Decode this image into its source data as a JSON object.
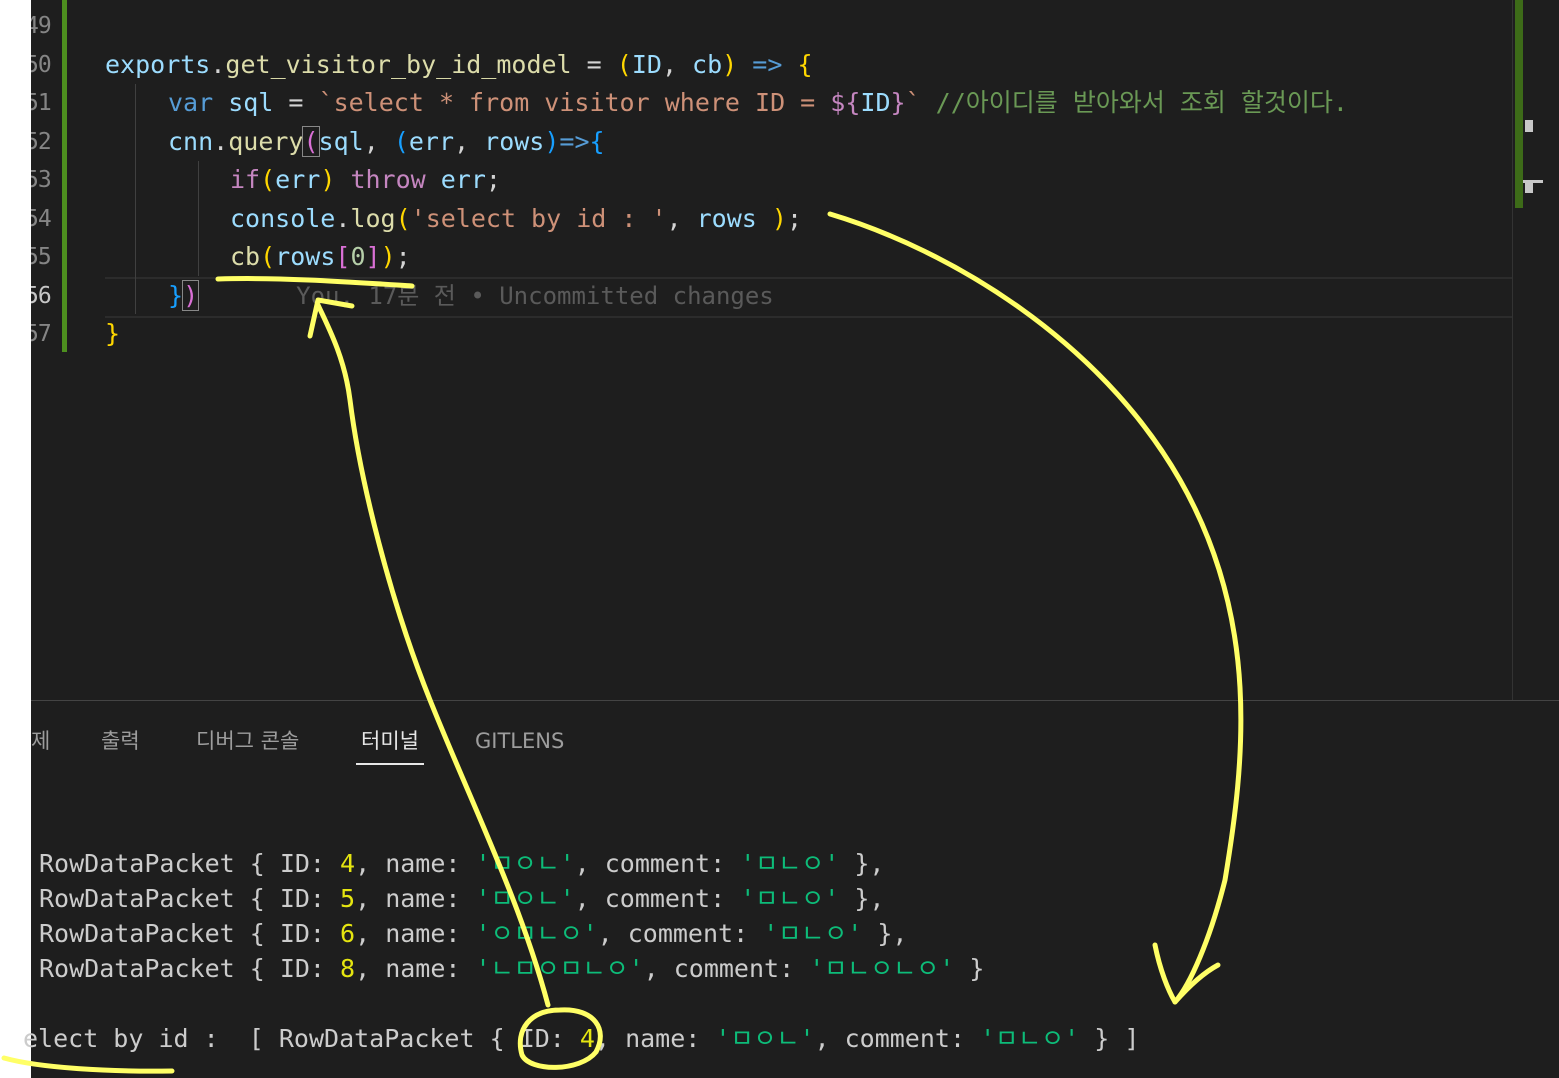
{
  "line_numbers": [
    "49",
    "50",
    "51",
    "52",
    "53",
    "54",
    "55",
    "56",
    "57"
  ],
  "code": {
    "l50": {
      "t1": "exports",
      "t2": ".",
      "t3": "get_visitor_by_id_model",
      "t4": " = ",
      "t5": "(",
      "t6": "ID",
      "t7": ", ",
      "t8": "cb",
      "t9": ")",
      "t10": " => ",
      "t11": "{"
    },
    "l51": {
      "t1": "var",
      "t2": " sql",
      "t3": " = ",
      "t4": "`select * from visitor where ID = ",
      "t5": "${",
      "t6": "ID",
      "t7": "}",
      "t8": "`",
      "t9": " //아이디를 받아와서 조회 할것이다."
    },
    "l52": {
      "t1": "cnn",
      "t2": ".",
      "t3": "query",
      "t4": "(",
      "t5": "sql",
      "t6": ", ",
      "t7": "(",
      "t8": "err",
      "t9": ", ",
      "t10": "rows",
      "t11": ")",
      "t12": "=>",
      "t13": "{"
    },
    "l53": {
      "t1": "if",
      "t2": "(",
      "t3": "err",
      "t4": ")",
      "t5": " throw",
      "t6": " err",
      "t7": ";"
    },
    "l54": {
      "t1": "console",
      "t2": ".",
      "t3": "log",
      "t4": "(",
      "t5": "'select by id : '",
      "t6": ", ",
      "t7": "rows",
      "t8": " ",
      "t9": ")",
      "t10": ";"
    },
    "l55": {
      "t1": "cb",
      "t2": "(",
      "t3": "rows",
      "t4": "[",
      "t5": "0",
      "t6": "]",
      "t7": ")",
      "t8": ";"
    },
    "l56": {
      "t1": "}",
      "t2": ")",
      "blame": "You, 17분 전 • Uncommitted changes"
    },
    "l57": {
      "t1": "}"
    }
  },
  "panel": {
    "tabs": [
      "제",
      "출력",
      "디버그 콘솔",
      "터미널",
      "GITLENS"
    ],
    "active_tab": "터미널"
  },
  "terminal": {
    "rows": [
      {
        "id": "4",
        "name": "'ㅁㅇㄴ'",
        "comment": "'ㅁㄴㅇ'",
        "end": " },"
      },
      {
        "id": "5",
        "name": "'ㅁㅇㄴ'",
        "comment": "'ㅁㄴㅇ'",
        "end": " },"
      },
      {
        "id": "6",
        "name": "'ㅇㅁㄴㅇ'",
        "comment": "'ㅁㄴㅇ'",
        "end": " },"
      },
      {
        "id": "8",
        "name": "'ㄴㅁㅇㅁㄴㅇ'",
        "comment": "'ㅁㄴㅇㄴㅇ'",
        "end": " }"
      }
    ],
    "row_prefix": "RowDataPacket { ID: ",
    "name_key": ", name: ",
    "comment_key": ", comment: ",
    "last_line": {
      "prefix": "elect by id :  [ RowDataPacket { ID: ",
      "id": "4",
      "name_key": ", name: ",
      "name": "'ㅁㅇㄴ'",
      "comment_key": ", comment: ",
      "comment": "'ㅁㄴㅇ'",
      "end": " } ]"
    }
  },
  "colors": {
    "annotation": "#ffff66",
    "editor_bg": "#1e1e1e",
    "git_added": "#4d8f1f"
  }
}
